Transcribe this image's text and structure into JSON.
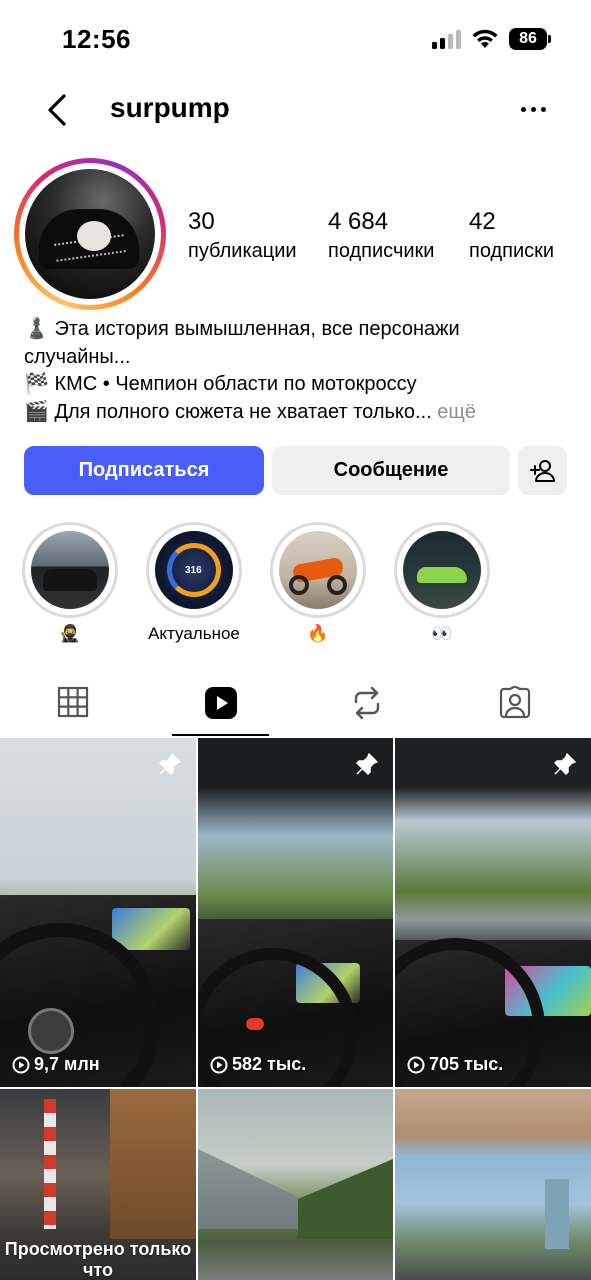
{
  "status_bar": {
    "time": "12:56",
    "battery": "86"
  },
  "header": {
    "username": "surpump"
  },
  "stats": [
    {
      "value": "30",
      "label": "публикации"
    },
    {
      "value": "4 684",
      "label": "подписчики"
    },
    {
      "value": "42",
      "label": "подписки"
    }
  ],
  "bio": {
    "line1": "♟️ Эта история вымышленная, все персонажи",
    "line2": "случайны...",
    "line3": "🏁 КМС • Чемпион области по мотокроссу",
    "line4": "🎬 Для полного сюжета не хватает только...",
    "more": " ещё"
  },
  "buttons": {
    "follow": "Подписаться",
    "message": "Сообщение"
  },
  "highlights": [
    {
      "label": "🥷"
    },
    {
      "label": "Актуальное"
    },
    {
      "label": "🔥"
    },
    {
      "label": "👀"
    }
  ],
  "tabs": [
    "grid-icon",
    "reels-icon",
    "reposts-icon",
    "tagged-icon"
  ],
  "active_tab": 1,
  "reels": [
    {
      "views": "9,7 млн",
      "pinned": true
    },
    {
      "views": "582 тыс.",
      "pinned": true
    },
    {
      "views": "705 тыс.",
      "pinned": true
    },
    {
      "overlay": "Просмотрено только что"
    },
    {},
    {}
  ],
  "colors": {
    "primary_button": "#4a5df9",
    "secondary_button": "#efefef"
  }
}
